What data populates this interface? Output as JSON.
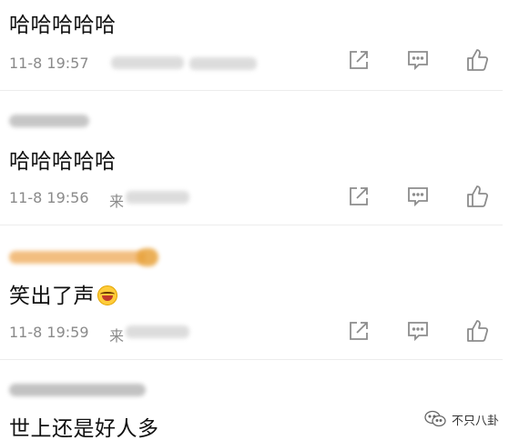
{
  "comments": [
    {
      "text": "哈哈哈哈哈",
      "time": "11-8 19:57"
    },
    {
      "text": "哈哈哈哈哈",
      "time": "11-8 19:56",
      "source_prefix": "来"
    },
    {
      "text": "笑出了声",
      "time": "11-8 19:59",
      "source_prefix": "来",
      "emoji": "laughing-crying-emoji"
    },
    {
      "text": "世上还是好人多"
    }
  ],
  "actions": {
    "share_icon": "share-icon",
    "comment_icon": "comment-icon",
    "like_icon": "like-icon",
    "icon_color": "#8c8c8c"
  },
  "watermark": {
    "text": "不只八卦"
  }
}
